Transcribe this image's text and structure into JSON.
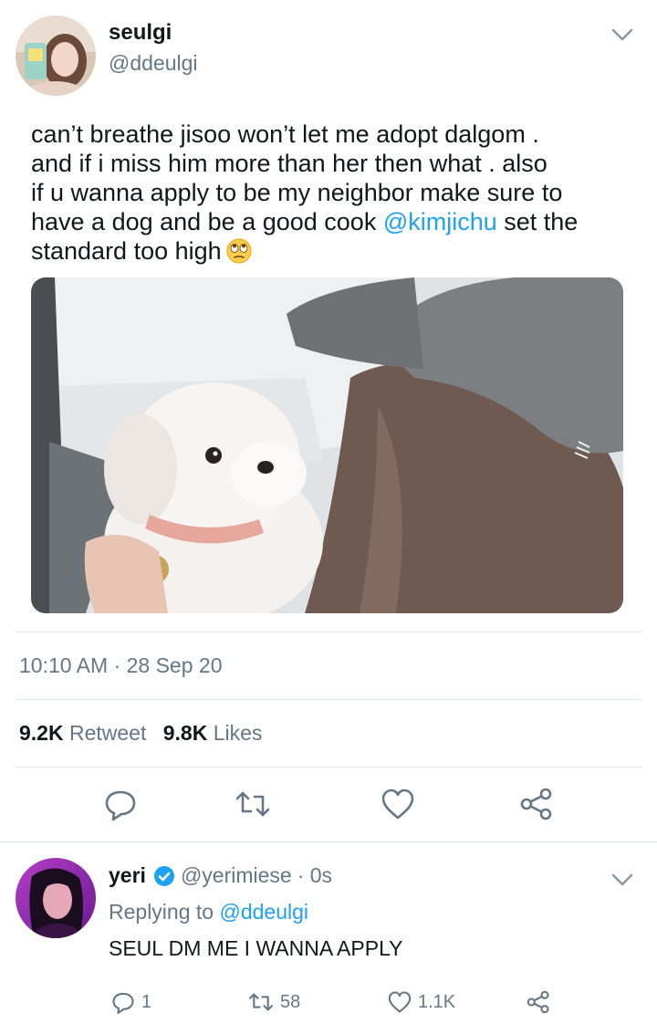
{
  "tweet": {
    "display_name": "seulgi",
    "handle": "@ddeulgi",
    "text_line1": "can’t breathe jisoo won’t let me adopt dalgom .",
    "text_line2": "and if i miss him more than her then what . also",
    "text_line3": "if u wanna apply to be my neighbor make sure to",
    "text_line4a": "have a dog and be a good cook ",
    "mention": "@kimjichu",
    "text_line4b": " set the",
    "text_line5": "standard too high",
    "emoji": "face-with-rolling-eyes",
    "media_alt": "photo of a small white dog with a pink collar next to a person in a grey cap",
    "timestamp": "10:10 AM · 28 Sep 20",
    "retweet_count": "9.2K",
    "retweet_label": "Retweet",
    "like_count": "9.8K",
    "like_label": "Likes",
    "actions": [
      "reply-icon",
      "retweet-icon",
      "like-icon",
      "share-icon"
    ]
  },
  "reply": {
    "display_name": "yeri",
    "handle": "@yerimiese",
    "time": "· 0s",
    "replying_prefix": "Replying to ",
    "replying_to": "@ddeulgi",
    "text": "SEUL DM ME I WANNA APPLY",
    "reply_count": "1",
    "retweet_count": "58",
    "like_count": "1.1K"
  },
  "colors": {
    "accent": "#1da1f2",
    "text": "#14171a",
    "muted": "#657786",
    "divider": "#e1e8ed"
  }
}
